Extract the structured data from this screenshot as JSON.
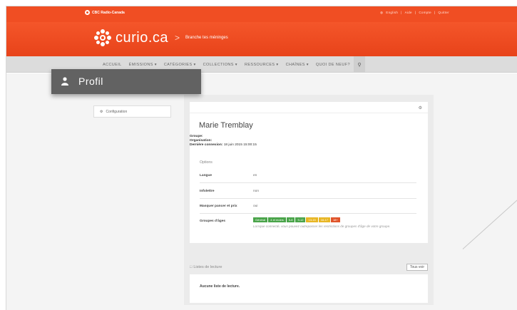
{
  "topbar": {
    "brand": "CBC Radio-Canada",
    "links": [
      "English",
      "Aide",
      "Compte",
      "Quitter"
    ],
    "colors": {
      "accent": "#f04e23"
    }
  },
  "header": {
    "logo_text": "curio.ca",
    "separator": ">",
    "tagline": "Branche tes méninges"
  },
  "nav": {
    "items": [
      "ACCUEIL",
      "ÉMISSIONS ▾",
      "CATÉGORIES ▾",
      "COLLECTIONS ▾",
      "RESSOURCES ▾",
      "CHAÎNES ▾",
      "QUOI DE NEUF?"
    ],
    "search_icon": "magnifier-icon"
  },
  "profil_popup": {
    "label": "Profil",
    "icon": "user-icon"
  },
  "leftmenu": {
    "item": "Configuration",
    "icon": "gear-icon"
  },
  "profile": {
    "name": "Marie Tremblay",
    "groupe_label": "Groupe:",
    "organisation_label": "Organisation:",
    "last_login_label": "Dernière connexion:",
    "last_login_value": "18 juin 2015 15:00:15",
    "options_title": "Options",
    "options": [
      {
        "label": "Langue",
        "value": "en"
      },
      {
        "label": "Infolettre",
        "value": "non"
      },
      {
        "label": "Masquer pancer et prix",
        "value": "oui"
      }
    ],
    "age_groups_label": "Groupes d'âges",
    "age_groups": [
      {
        "label": "Général",
        "color": "#4aa44a"
      },
      {
        "label": "4 et moins",
        "color": "#4aa44a"
      },
      {
        "label": "5-8",
        "color": "#4aa44a"
      },
      {
        "label": "9-12",
        "color": "#4aa44a"
      },
      {
        "label": "13-15",
        "color": "#e8b624"
      },
      {
        "label": "16-17",
        "color": "#e8b624"
      },
      {
        "label": "18+",
        "color": "#e0542a"
      }
    ],
    "age_groups_note": "Lorsque connecté, vous pouvez outrepasser les restrictions de groupes d'âge de votre groupe."
  },
  "reading_lists": {
    "title": "Listes de lecture",
    "see_all": "Tous voir",
    "empty": "Aucune liste de lecture."
  }
}
